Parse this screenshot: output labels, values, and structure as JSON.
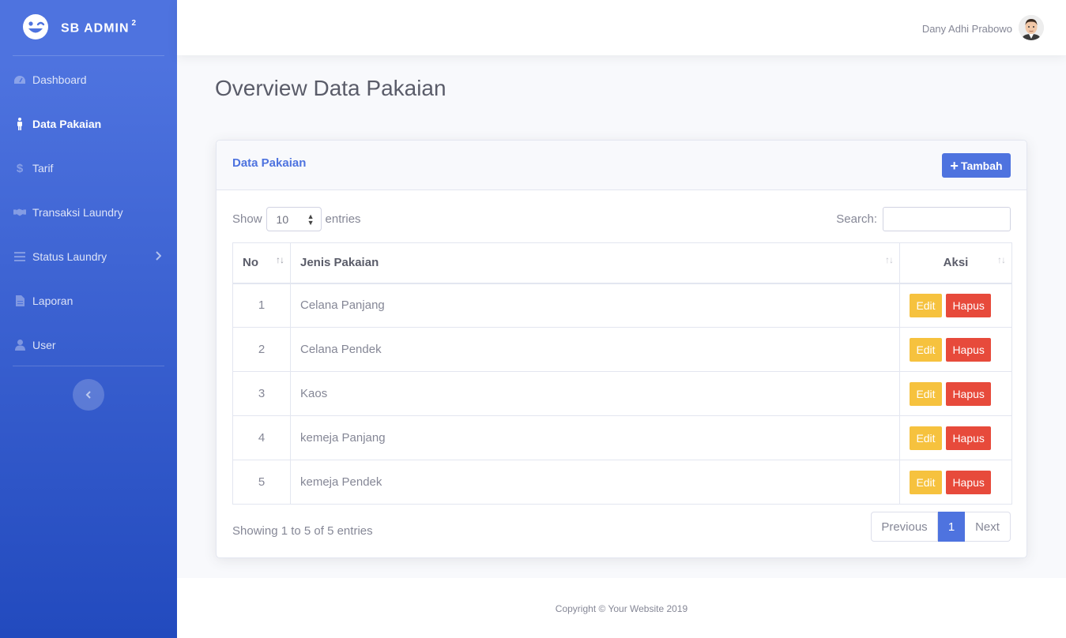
{
  "sidebar": {
    "brand_text": "SB ADMIN",
    "brand_sup": "2",
    "items": [
      {
        "label": "Dashboard",
        "icon": "tachometer-icon"
      },
      {
        "label": "Data Pakaian",
        "icon": "male-icon",
        "active": true
      },
      {
        "label": "Tarif",
        "icon": "dollar-icon"
      },
      {
        "label": "Transaksi Laundry",
        "icon": "handshake-icon"
      },
      {
        "label": "Status Laundry",
        "icon": "bars-icon"
      },
      {
        "label": "Laporan",
        "icon": "file-icon"
      },
      {
        "label": "User",
        "icon": "user-icon"
      }
    ]
  },
  "topbar": {
    "user_name": "Dany Adhi Prabowo"
  },
  "page": {
    "title": "Overview Data Pakaian"
  },
  "card": {
    "title": "Data Pakaian",
    "add_button": "Tambah",
    "show_label": "Show",
    "entries_label": "entries",
    "entries_value": "10",
    "search_label": "Search:",
    "columns": [
      "No",
      "Jenis Pakaian",
      "Aksi"
    ],
    "rows": [
      {
        "no": "1",
        "jenis": "Celana Panjang"
      },
      {
        "no": "2",
        "jenis": "Celana Pendek"
      },
      {
        "no": "3",
        "jenis": "Kaos"
      },
      {
        "no": "4",
        "jenis": "kemeja Panjang"
      },
      {
        "no": "5",
        "jenis": "kemeja Pendek"
      }
    ],
    "edit_label": "Edit",
    "delete_label": "Hapus",
    "info": "Showing 1 to 5 of 5 entries",
    "pagination": {
      "previous": "Previous",
      "current": "1",
      "next": "Next"
    }
  },
  "footer": {
    "copyright": "Copyright © Your Website 2019"
  },
  "colors": {
    "primary": "#4e73df",
    "warning": "#f6c23e",
    "danger": "#e74a3b"
  }
}
